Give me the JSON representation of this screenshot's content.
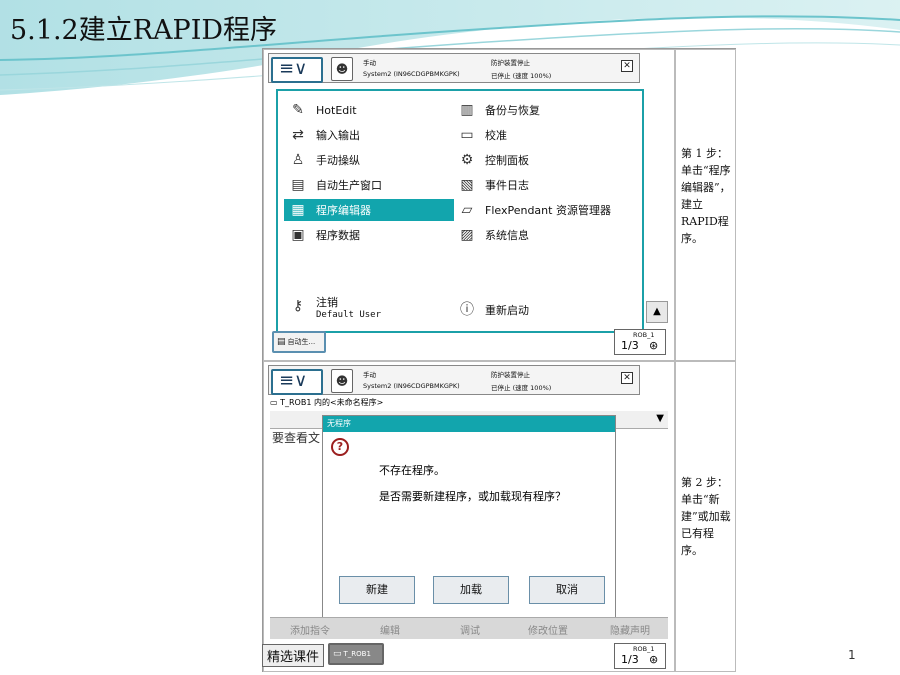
{
  "slide": {
    "title": "5.1.2建立RAPID程序",
    "page_number": "1",
    "watermark": "精选课件"
  },
  "screen1": {
    "menu_symbol": "≡∨",
    "mode": "手动",
    "system": "System2 (IN96CDGPBMKGPK)",
    "guard": "防护装置停止",
    "state": "已停止 (速度 100%)",
    "menu_left": [
      {
        "icon": "hotedit-icon",
        "glyph": "✎",
        "label": "HotEdit"
      },
      {
        "icon": "io-icon",
        "glyph": "⇄",
        "label": "输入输出"
      },
      {
        "icon": "jogging-icon",
        "glyph": "♙",
        "label": "手动操纵"
      },
      {
        "icon": "auto-window-icon",
        "glyph": "▤",
        "label": "自动生产窗口"
      },
      {
        "icon": "program-editor-icon",
        "glyph": "▦",
        "label": "程序编辑器"
      },
      {
        "icon": "program-data-icon",
        "glyph": "▣",
        "label": "程序数据"
      }
    ],
    "menu_right": [
      {
        "icon": "backup-icon",
        "glyph": "▥",
        "label": "备份与恢复"
      },
      {
        "icon": "calibration-icon",
        "glyph": "▭",
        "label": "校准"
      },
      {
        "icon": "control-panel-icon",
        "glyph": "⚙",
        "label": "控制面板"
      },
      {
        "icon": "event-log-icon",
        "glyph": "▧",
        "label": "事件日志"
      },
      {
        "icon": "file-explorer-icon",
        "glyph": "▱",
        "label": "FlexPendant 资源管理器"
      },
      {
        "icon": "system-info-icon",
        "glyph": "▨",
        "label": "系统信息"
      }
    ],
    "logout_label": "注销",
    "user_label": "Default User",
    "restart_label": "重新启动",
    "task_label": "自动生...",
    "rob_label": "ROB_1",
    "rob_fraction": "1/3"
  },
  "screen2": {
    "menu_symbol": "≡∨",
    "mode": "手动",
    "system": "System2 (IN96CDGPBMKGPK)",
    "guard": "防护装置停止",
    "state": "已停止 (速度 100%)",
    "breadcrumb": "T_ROB1 内的<未命名程序>",
    "hidden_text": "要查看文",
    "dialog_title": "无程序",
    "dialog_line1": "不存在程序。",
    "dialog_line2": "是否需要新建程序，或加载现有程序？",
    "btn_new": "新建",
    "btn_load": "加载",
    "btn_cancel": "取消",
    "bottom_items": [
      "添加指令",
      "编辑",
      "调试",
      "修改位置",
      "隐藏声明"
    ],
    "task_label": "T_ROB1",
    "rob_label": "ROB_1",
    "rob_fraction": "1/3"
  },
  "steps": {
    "step1": "第 1 步：单击“程序编辑器”，建立RAPID程序。",
    "step2": "第 2 步：单击“新建”或加载已有程序。"
  }
}
